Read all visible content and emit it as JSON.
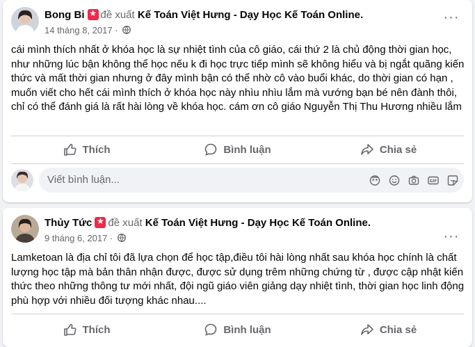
{
  "posts": [
    {
      "author": "Bong Bi",
      "recommends": "đề xuất",
      "page": "Kế Toán Việt Hưng - Dạy Học Kế Toán Online",
      "date": "14 tháng 8, 2017 ·",
      "body": "cái mình thích nhất ở khóa học là sự nhiệt tình của cô giáo, cái thứ 2 là chủ động thời gian học, như những lúc bận không thể học nếu k đi học trực tiếp mình sẽ không  hiểu và bị ngắt quãng kiến thức và mất thời gian nhưng ở đây mình  bận có thể nhờ cô vào buổi khác, do thời gian có hạn ,  muốn viết cho hết cái mình thích ở khóa học này nhìu nhìu lắm mà vướng bạn bé nên đành thôi, chỉ có thể đánh giá là rất hài lòng về khóa học. cám ơn cô giáo Nguyễn Thị Thu Hương nhiều lắm",
      "more_icon": "more-horizontal-icon"
    },
    {
      "author": "Thủy Tức",
      "recommends": "đề xuất",
      "page": "Kế Toán Việt Hưng - Dạy Học Kế Toán Online",
      "date": "9 tháng 6, 2017 ·",
      "body": "Lamketoan là địa chỉ tôi đã lựa chọn để học tập,điều tôi hài lòng nhất sau khóa học chính là chất lượng học tập mà bản thân nhận được, được sử dụng trêm những chứng từ , được cập nhật kiến thức theo những thông tư mới nhất, đội ngũ giáo viên giảng dạy nhiệt tình, thời gian học linh động phù hợp với nhiều đối tượng khác nhau....",
      "more_icon": "more-horizontal-icon"
    }
  ],
  "actions": {
    "like": "Thích",
    "comment": "Bình luận",
    "share": "Chia sẻ"
  },
  "comment_box": {
    "placeholder": "Viết bình luận..."
  },
  "colors": {
    "secondary_text": "#65676b",
    "recommend_badge": "#f02849",
    "divider": "#ced0d4",
    "background": "#f0f2f5"
  }
}
